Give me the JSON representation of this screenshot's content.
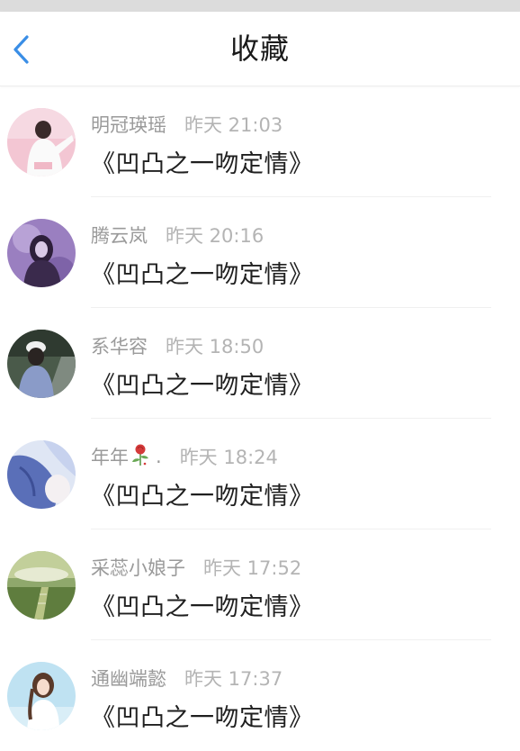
{
  "header": {
    "title": "收藏"
  },
  "items": [
    {
      "name": "明冠瑛瑶",
      "time": "昨天 21:03",
      "title": "《凹凸之一吻定情》"
    },
    {
      "name": "腾云岚",
      "time": "昨天 20:16",
      "title": "《凹凸之一吻定情》"
    },
    {
      "name": "系华容",
      "time": "昨天 18:50",
      "title": "《凹凸之一吻定情》"
    },
    {
      "name": "年年",
      "name_suffix": ".",
      "time": "昨天 18:24",
      "title": "《凹凸之一吻定情》"
    },
    {
      "name": "采蕊小娘子",
      "time": "昨天 17:52",
      "title": "《凹凸之一吻定情》"
    },
    {
      "name": "通幽端懿",
      "time": "昨天 17:37",
      "title": "《凹凸之一吻定情》"
    }
  ],
  "colors": {
    "accent": "#3a8ee6",
    "title_text": "#1a1a1a",
    "name_text": "#9a9a9a",
    "time_text": "#b4b4b4"
  }
}
